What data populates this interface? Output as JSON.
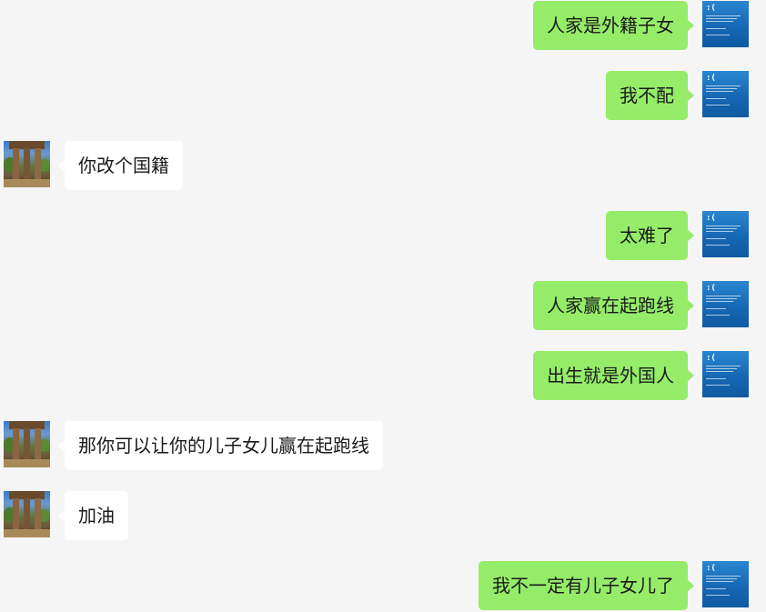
{
  "messages": [
    {
      "side": "mine",
      "text": "人家是外籍子女"
    },
    {
      "side": "mine",
      "text": "我不配"
    },
    {
      "side": "theirs",
      "text": "你改个国籍"
    },
    {
      "side": "mine",
      "text": "太难了"
    },
    {
      "side": "mine",
      "text": "人家赢在起跑线"
    },
    {
      "side": "mine",
      "text": "出生就是外国人"
    },
    {
      "side": "theirs",
      "text": "那你可以让你的儿子女儿赢在起跑线"
    },
    {
      "side": "theirs",
      "text": "加油"
    },
    {
      "side": "mine",
      "text": "我不一定有儿子女儿了"
    }
  ],
  "self_avatar": {
    "icon": "bluescreen-avatar-icon",
    "face": ":("
  },
  "friend_avatar": {
    "icon": "landscape-photo-avatar-icon"
  },
  "colors": {
    "background": "#f5f5f5",
    "mine_bubble": "#95ec69",
    "theirs_bubble": "#ffffff",
    "text": "#1a1a1a"
  }
}
